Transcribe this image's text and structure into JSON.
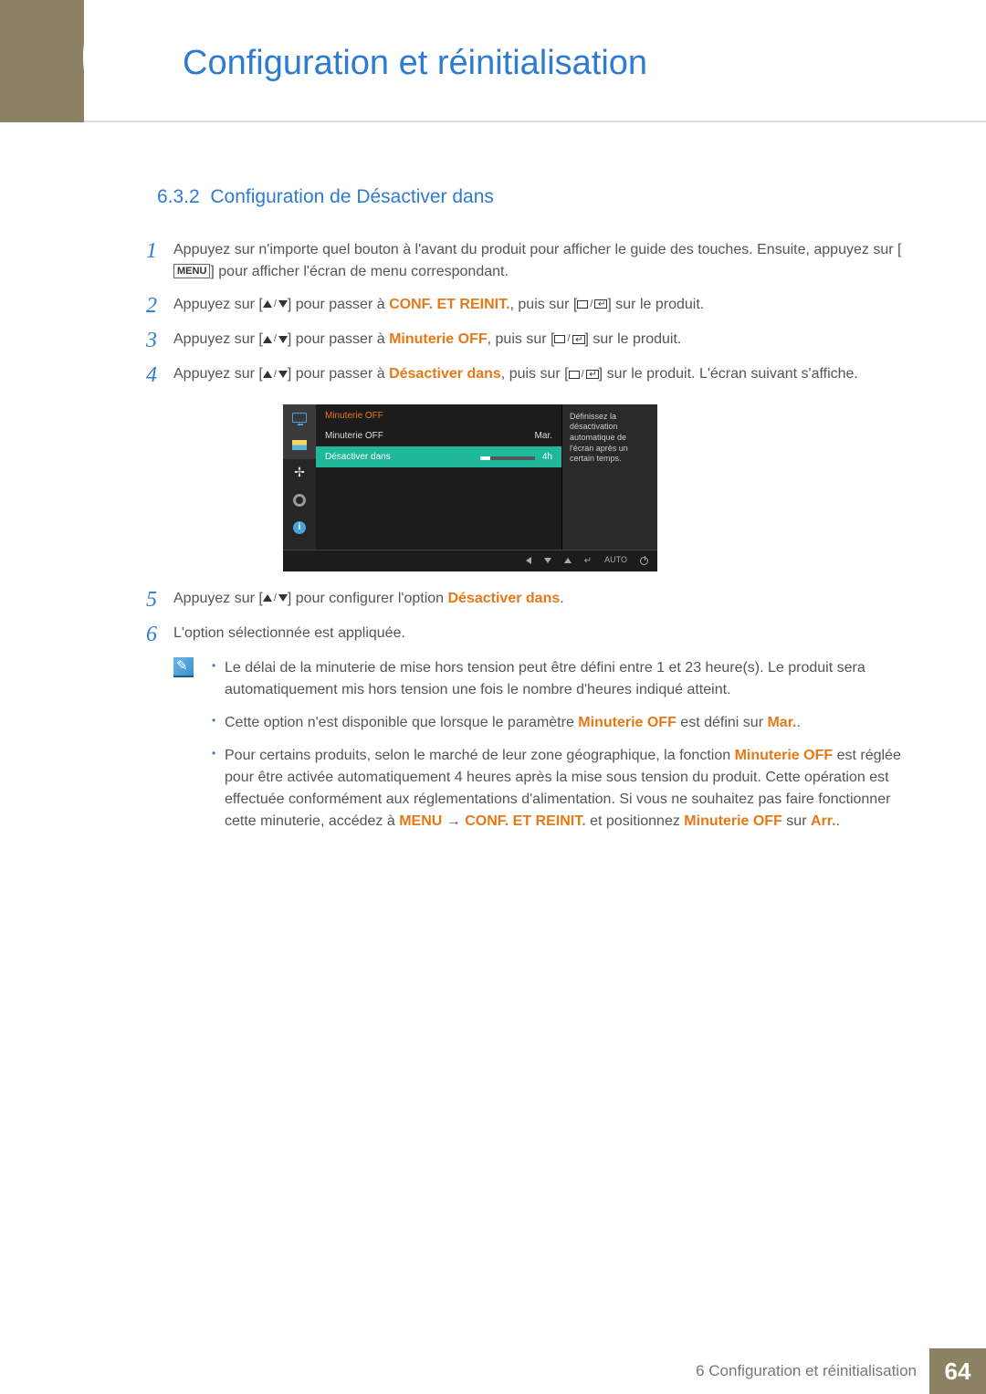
{
  "chapter": {
    "num": "6",
    "title": "Configuration et réinitialisation"
  },
  "section": {
    "num": "6.3.2",
    "title": "Configuration de Désactiver dans"
  },
  "labels": {
    "menu": "MENU",
    "auto": "AUTO"
  },
  "steps": [
    {
      "n": "1",
      "pre": "Appuyez sur n'importe quel bouton à l'avant du produit pour afficher le guide des touches. Ensuite, appuyez sur [",
      "mid_label": "menu",
      "post": "] pour afficher l'écran de menu correspondant."
    },
    {
      "n": "2",
      "t1": "Appuyez sur [",
      "t2": "] pour passer à ",
      "hl": "CONF. ET REINIT.",
      "t3": ", puis sur [",
      "t4": "] sur le produit."
    },
    {
      "n": "3",
      "t1": "Appuyez sur [",
      "t2": "] pour passer à ",
      "hl": "Minuterie OFF",
      "t3": ", puis sur [",
      "t4": "] sur le produit."
    },
    {
      "n": "4",
      "t1": "Appuyez sur [",
      "t2": "] pour passer à ",
      "hl": "Désactiver dans",
      "t3": ", puis sur [",
      "t4": "] sur le produit. L'écran suivant s'affiche."
    },
    {
      "n": "5",
      "t1": "Appuyez sur [",
      "t2": "] pour configurer l'option ",
      "hl": "Désactiver dans",
      "t3": "."
    },
    {
      "n": "6",
      "plain": "L'option sélectionnée est appliquée."
    }
  ],
  "osd": {
    "header": "Minuterie OFF",
    "row1": {
      "label": "Minuterie OFF",
      "val": "Mar."
    },
    "row2": {
      "label": "Désactiver dans",
      "val": "4h"
    },
    "tip": "Définissez la désactivation automatique de l'écran après un certain temps."
  },
  "notes": [
    {
      "text": "Le délai de la minuterie de mise hors tension peut être défini entre 1 et 23 heure(s). Le produit sera automatiquement mis hors tension une fois le nombre d'heures indiqué atteint."
    },
    {
      "pre": "Cette option n'est disponible que lorsque le paramètre ",
      "hl1": "Minuterie OFF",
      "mid": " est défini sur ",
      "hl2": "Mar.",
      "post": "."
    },
    {
      "pre": "Pour certains produits, selon le marché de leur zone géographique, la fonction ",
      "hl1": "Minuterie OFF",
      "mid": " est réglée pour être activée automatiquement 4 heures après la mise sous tension du produit. Cette opération est effectuée conformément aux réglementations d'alimentation. Si vous ne souhaitez pas faire fonctionner cette minuterie, accédez à ",
      "hl2": "MENU",
      "arrow": " → ",
      "hl3": "CONF. ET REINIT.",
      "mid2": " et positionnez ",
      "hl4": "Minuterie OFF",
      "mid3": " sur ",
      "hl5": "Arr.",
      "post": "."
    }
  ],
  "footer": {
    "text": "6 Configuration et réinitialisation",
    "page": "64"
  }
}
